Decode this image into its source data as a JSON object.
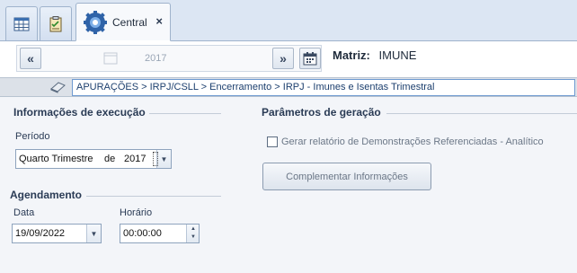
{
  "tabs": {
    "main_label": "Central",
    "close_glyph": "×"
  },
  "nav": {
    "prev_glyph": "«",
    "next_glyph": "»",
    "year": "2017",
    "matriz_label": "Matriz:",
    "matriz_value": "IMUNE"
  },
  "breadcrumb": {
    "path": "APURAÇÕES > IRPJ/CSLL > Encerramento > IRPJ - Imunes e Isentas Trimestral"
  },
  "execucao": {
    "title": "Informações de execução",
    "periodo_label": "Período",
    "periodo_value": "Quarto Trimestre",
    "de_label": "de",
    "ano_value": "2017"
  },
  "agendamento": {
    "title": "Agendamento",
    "data_label": "Data",
    "data_value": "19/09/2022",
    "horario_label": "Horário",
    "horario_value": "00:00:00"
  },
  "geracao": {
    "title": "Parâmetros de geração",
    "checkbox_label": "Gerar relatório de Demonstrações Referenciadas - Analítico",
    "checkbox_checked": false,
    "complement_button": "Complementar Informações"
  },
  "colors": {
    "accent": "#6f9bd1",
    "tab_bg": "#dce6f3",
    "text": "#2a3b55"
  }
}
